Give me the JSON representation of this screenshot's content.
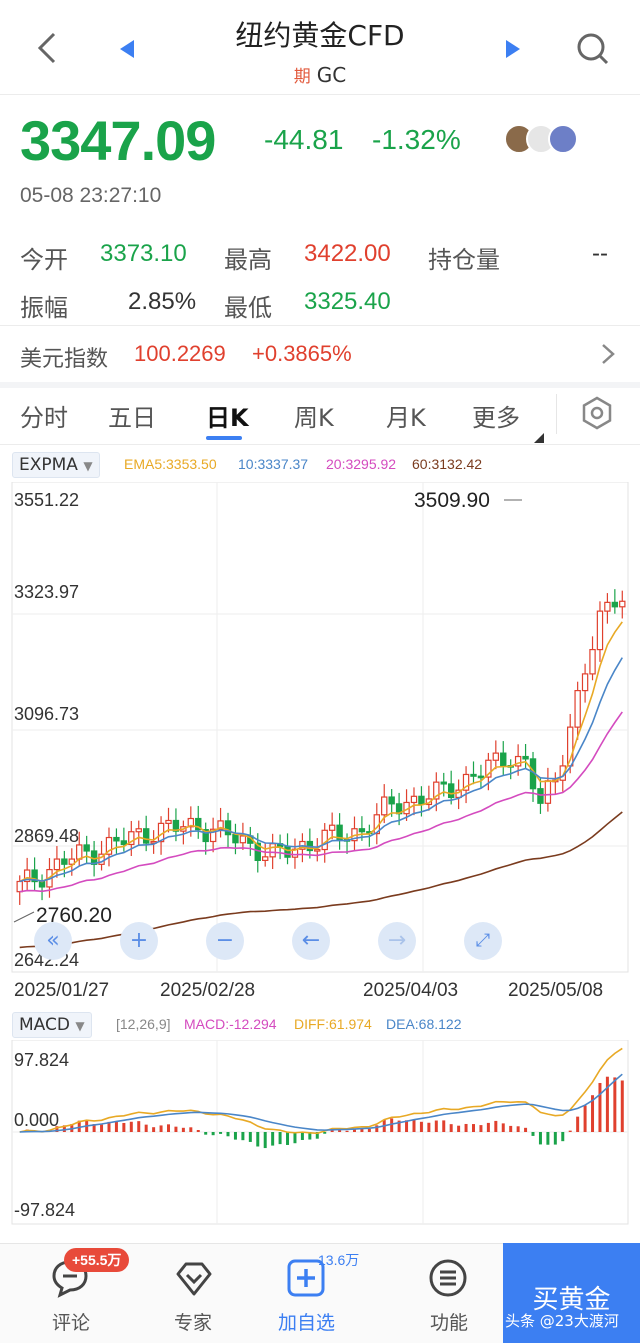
{
  "header": {
    "title": "纽约黄金CFD",
    "badge": "期",
    "code": "GC"
  },
  "quote": {
    "price": "3347.09",
    "change": "-44.81",
    "change_pct": "-1.32%",
    "time": "05-08 23:27:10"
  },
  "stats": {
    "open_label": "今开",
    "open_value": "3373.10",
    "high_label": "最高",
    "high_value": "3422.00",
    "oi_label": "持仓量",
    "oi_value": "--",
    "amp_label": "振幅",
    "amp_value": "2.85%",
    "low_label": "最低",
    "low_value": "3325.40"
  },
  "usd_index": {
    "label": "美元指数",
    "value": "100.2269",
    "change": "+0.3865%"
  },
  "tabs": [
    "分时",
    "五日",
    "日K",
    "周K",
    "月K",
    "更多"
  ],
  "main_indicator": {
    "name": "EXPMA",
    "ema5": "EMA5:3353.50",
    "ema10": "10:3337.37",
    "ema20": "20:3295.92",
    "ema60": "60:3132.42"
  },
  "macd_indicator": {
    "name": "MACD",
    "params": "[12,26,9]",
    "macd": "MACD:-12.294",
    "diff": "DIFF:61.974",
    "dea": "DEA:68.122"
  },
  "chart_data": {
    "type": "candlestick",
    "y_ticks": [
      "3551.22",
      "3323.97",
      "3096.73",
      "2869.48",
      "2642.24"
    ],
    "x_ticks": [
      "2025/01/27",
      "2025/02/28",
      "2025/04/03",
      "2025/05/08"
    ],
    "high_marker": "3509.90",
    "low_marker": "2760.20",
    "ylim": [
      2642.24,
      3551.22
    ],
    "macd_ticks": [
      "97.824",
      "0.000",
      "-97.824"
    ],
    "colors": {
      "up": "#e0402e",
      "down": "#1aa34a",
      "ema5": "#e8a925",
      "ema10": "#4a86c8",
      "ema20": "#d44bbf",
      "ema60": "#7a3b1e"
    }
  },
  "bottom_nav": {
    "comments_label": "评论",
    "comments_badge": "+55.5万",
    "expert_label": "专家",
    "watch_label": "加自选",
    "watch_count": "13.6万",
    "func_label": "功能",
    "buy_label": "买黄金",
    "watermark": "头条 @23大渡河"
  }
}
